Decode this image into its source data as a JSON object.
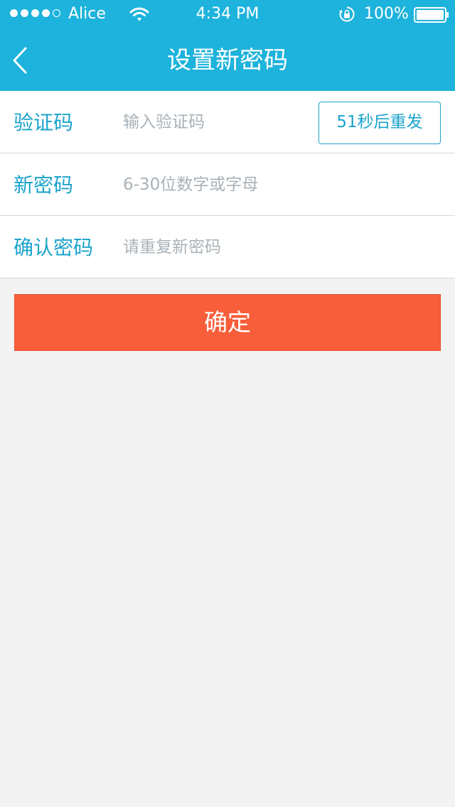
{
  "colors": {
    "header": "#1db3dc",
    "accent_text": "#1aa3cc",
    "confirm_button": "#f95e3a",
    "background": "#f3f3f3",
    "placeholder": "#a9b2b8"
  },
  "status_bar": {
    "signal_bars_filled": 4,
    "signal_bars_total": 5,
    "carrier": "Alice",
    "wifi_icon": "wifi-icon",
    "time": "4:34 PM",
    "rotation_lock_icon": "rotation-lock-icon",
    "battery_percent": "100%",
    "battery_icon": "battery-icon",
    "battery_level": 1.0
  },
  "nav": {
    "back_icon": "chevron-left-icon",
    "title": "设置新密码"
  },
  "form": {
    "code": {
      "label": "验证码",
      "placeholder": "输入验证码",
      "value": "",
      "resend_label": "51秒后重发"
    },
    "new_password": {
      "label": "新密码",
      "placeholder": "6-30位数字或字母",
      "value": ""
    },
    "confirm_password": {
      "label": "确认密码",
      "placeholder": "请重复新密码",
      "value": ""
    }
  },
  "confirm_button": {
    "label": "确定"
  }
}
